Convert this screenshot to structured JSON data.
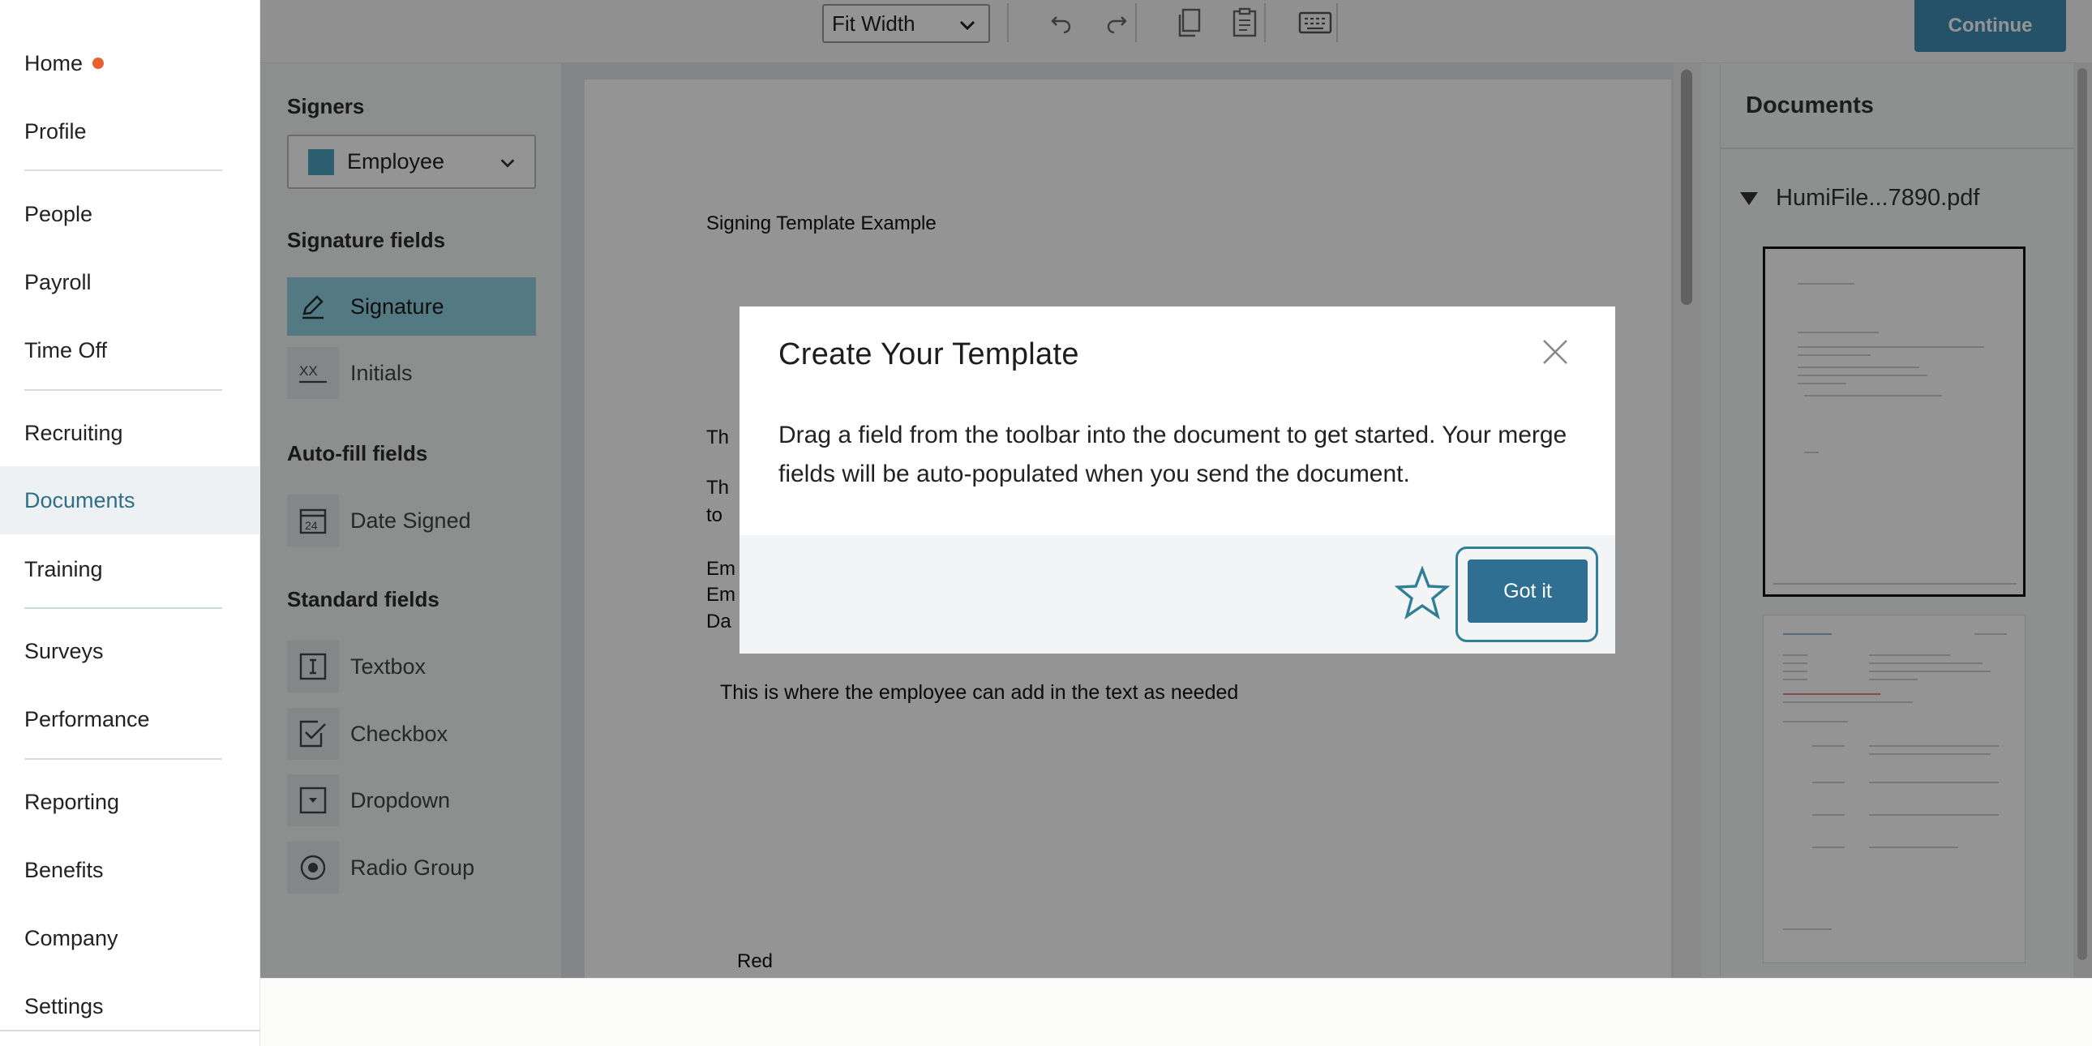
{
  "nav": {
    "items": [
      {
        "label": "Home"
      },
      {
        "label": "Profile"
      },
      {
        "label": "People"
      },
      {
        "label": "Payroll"
      },
      {
        "label": "Time Off"
      },
      {
        "label": "Recruiting"
      },
      {
        "label": "Documents"
      },
      {
        "label": "Training"
      },
      {
        "label": "Surveys"
      },
      {
        "label": "Performance"
      },
      {
        "label": "Reporting"
      },
      {
        "label": "Benefits"
      },
      {
        "label": "Company"
      },
      {
        "label": "Settings"
      }
    ],
    "active": "Documents",
    "notification_color": "#e8602f"
  },
  "toolbar": {
    "zoom": "Fit Width",
    "icons": [
      "undo-icon",
      "redo-icon",
      "copy-icon",
      "paste-icon",
      "keyboard-icon"
    ],
    "continue_label": "Continue"
  },
  "fields_panel": {
    "signers_heading": "Signers",
    "signer": "Employee",
    "signer_color": "#4aa3bf",
    "signature_heading": "Signature fields",
    "signature_fields": [
      {
        "label": "Signature",
        "icon": "pen-icon"
      },
      {
        "label": "Initials",
        "icon": "initials-icon"
      }
    ],
    "autofill_heading": "Auto-fill fields",
    "autofill_fields": [
      {
        "label": "Date Signed",
        "icon": "calendar-icon"
      }
    ],
    "standard_heading": "Standard fields",
    "standard_fields": [
      {
        "label": "Textbox",
        "icon": "textbox-icon"
      },
      {
        "label": "Checkbox",
        "icon": "checkbox-icon"
      },
      {
        "label": "Dropdown",
        "icon": "dropdown-icon"
      },
      {
        "label": "Radio Group",
        "icon": "radio-icon"
      }
    ]
  },
  "document": {
    "title": "Signing Template Example",
    "fragments": [
      "Th",
      "Th",
      "to",
      "Em",
      "Em",
      "Da"
    ],
    "body_text": "This is where the employee can add in the text as needed",
    "footer_text": "Red"
  },
  "documents_panel": {
    "title": "Documents",
    "file_name": "HumiFile...7890.pdf"
  },
  "modal": {
    "title": "Create Your Template",
    "body": "Drag a field from the toolbar into the document to get started. Your merge fields will be auto-populated when you send the document.",
    "button_label": "Got it"
  }
}
